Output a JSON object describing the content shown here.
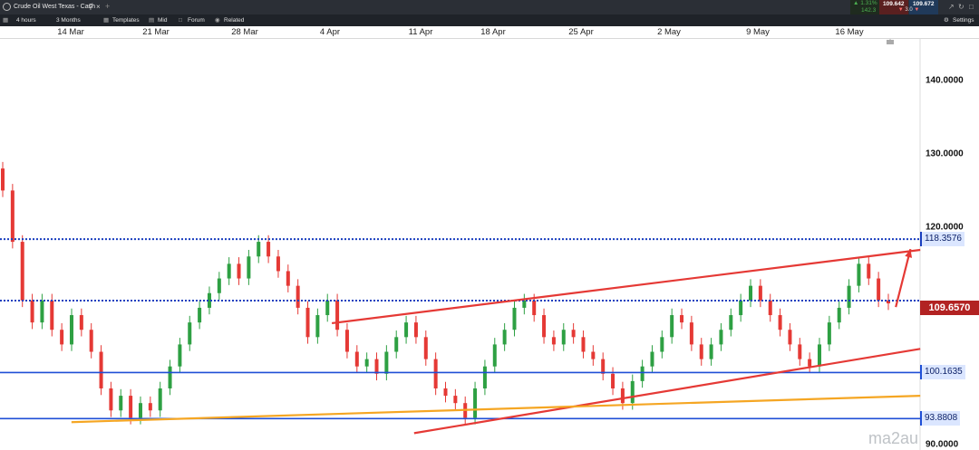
{
  "window": {
    "tab_title": "Crude Oil West Texas - Cash",
    "add_tab": "+"
  },
  "quotes": {
    "change_pct": "1.31%",
    "change_pts": "142.3",
    "sell": "109.642",
    "spread": "3.0",
    "buy": "109.672"
  },
  "toolbar": {
    "timeframe": "4 hours",
    "range": "3 Months",
    "templates": "Templates",
    "mid": "Mid",
    "forum": "Forum",
    "related": "Related",
    "settings": "Settings"
  },
  "chart_data": {
    "type": "candlestick",
    "instrument": "Crude Oil West Texas - Cash",
    "x_tick_labels": [
      "14 Mar",
      "21 Mar",
      "28 Mar",
      "4 Apr",
      "11 Apr",
      "18 Apr",
      "25 Apr",
      "2 May",
      "9 May",
      "16 May"
    ],
    "y_tick_labels": [
      "140.0000",
      "130.0000",
      "120.0000",
      "90.0000"
    ],
    "ylim": [
      89.6,
      145.8
    ],
    "current_price": "109.6570",
    "levels": [
      {
        "label": "118.3576",
        "value": 118.3576,
        "style": "dotted",
        "color": "#1a3fbf"
      },
      {
        "label": "109.6570",
        "value": 109.98,
        "style": "dotted",
        "color": "#1a3fbf"
      },
      {
        "label": "100.1635",
        "value": 100.1635,
        "style": "solid",
        "color": "#1f4fd6"
      },
      {
        "label": "93.8808",
        "value": 93.8808,
        "style": "solid",
        "color": "#1f4fd6"
      }
    ],
    "trendlines": [
      {
        "color": "#e53935",
        "from": [
          0.339,
          106.9
        ],
        "to": [
          0.94,
          116.9
        ]
      },
      {
        "color": "#e53935",
        "from": [
          0.423,
          91.9
        ],
        "to": [
          0.94,
          103.4
        ]
      },
      {
        "color": "#f5a623",
        "from": [
          0.073,
          93.4
        ],
        "to": [
          0.94,
          97.0
        ]
      },
      {
        "color": "#e53935",
        "from": [
          0.915,
          109.1
        ],
        "to": [
          0.93,
          117.0
        ],
        "arrow": true
      }
    ],
    "candles_approx": [
      [
        128,
        125
      ],
      [
        125,
        118
      ],
      [
        118,
        110
      ],
      [
        110,
        107
      ],
      [
        107,
        110
      ],
      [
        110,
        106
      ],
      [
        106,
        104
      ],
      [
        104,
        108
      ],
      [
        108,
        106
      ],
      [
        106,
        103
      ],
      [
        103,
        98
      ],
      [
        98,
        95
      ],
      [
        95,
        97
      ],
      [
        97,
        94
      ],
      [
        94,
        96
      ],
      [
        96,
        95
      ],
      [
        95,
        98
      ],
      [
        98,
        101
      ],
      [
        101,
        104
      ],
      [
        104,
        107
      ],
      [
        107,
        109
      ],
      [
        109,
        111
      ],
      [
        111,
        113
      ],
      [
        113,
        115
      ],
      [
        115,
        113
      ],
      [
        113,
        116
      ],
      [
        116,
        118
      ],
      [
        118,
        116
      ],
      [
        116,
        114
      ],
      [
        114,
        112
      ],
      [
        112,
        109
      ],
      [
        109,
        105
      ],
      [
        105,
        108
      ],
      [
        108,
        110
      ],
      [
        110,
        106
      ],
      [
        106,
        103
      ],
      [
        103,
        101
      ],
      [
        101,
        102
      ],
      [
        102,
        100
      ],
      [
        100,
        103
      ],
      [
        103,
        105
      ],
      [
        105,
        107
      ],
      [
        107,
        105
      ],
      [
        105,
        102
      ],
      [
        102,
        98
      ],
      [
        98,
        97
      ],
      [
        97,
        96
      ],
      [
        96,
        94
      ],
      [
        94,
        98
      ],
      [
        98,
        101
      ],
      [
        101,
        104
      ],
      [
        104,
        106
      ],
      [
        106,
        109
      ],
      [
        109,
        110
      ],
      [
        110,
        108
      ],
      [
        108,
        105
      ],
      [
        105,
        104
      ],
      [
        104,
        106
      ],
      [
        106,
        105
      ],
      [
        105,
        103
      ],
      [
        103,
        102
      ],
      [
        102,
        100
      ],
      [
        100,
        98
      ],
      [
        98,
        96
      ],
      [
        96,
        99
      ],
      [
        99,
        101
      ],
      [
        101,
        103
      ],
      [
        103,
        105
      ],
      [
        105,
        108
      ],
      [
        108,
        107
      ],
      [
        107,
        104
      ],
      [
        104,
        102
      ],
      [
        102,
        104
      ],
      [
        104,
        106
      ],
      [
        106,
        108
      ],
      [
        108,
        110
      ],
      [
        110,
        112
      ],
      [
        112,
        110
      ],
      [
        110,
        108
      ],
      [
        108,
        106
      ],
      [
        106,
        104
      ],
      [
        104,
        102
      ],
      [
        102,
        101
      ],
      [
        101,
        104
      ],
      [
        104,
        107
      ],
      [
        107,
        109
      ],
      [
        109,
        112
      ],
      [
        112,
        115
      ],
      [
        115,
        113
      ],
      [
        113,
        110
      ],
      [
        110,
        109.6
      ]
    ]
  },
  "watermark": "ma2au"
}
